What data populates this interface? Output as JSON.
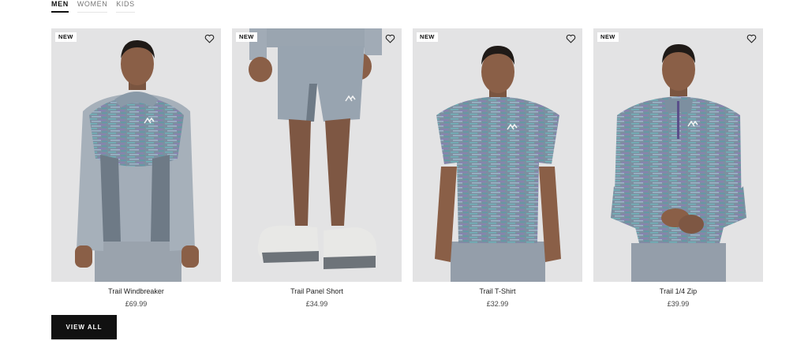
{
  "tabs": [
    {
      "label": "MEN",
      "active": true
    },
    {
      "label": "WOMEN",
      "active": false
    },
    {
      "label": "KIDS",
      "active": false
    }
  ],
  "products": [
    {
      "badge": "NEW",
      "name": "Trail Windbreaker",
      "price": "£69.99"
    },
    {
      "badge": "NEW",
      "name": "Trail Panel Short",
      "price": "£34.99"
    },
    {
      "badge": "NEW",
      "name": "Trail T-Shirt",
      "price": "£32.99"
    },
    {
      "badge": "NEW",
      "name": "Trail 1/4 Zip",
      "price": "£39.99"
    }
  ],
  "view_all_label": "VIEW ALL",
  "colors": {
    "image_bg": "#e3e3e4",
    "button_bg": "#111111",
    "garment_grey": "#8f9aa5",
    "space_dye_teal": "#6fa7b3"
  }
}
